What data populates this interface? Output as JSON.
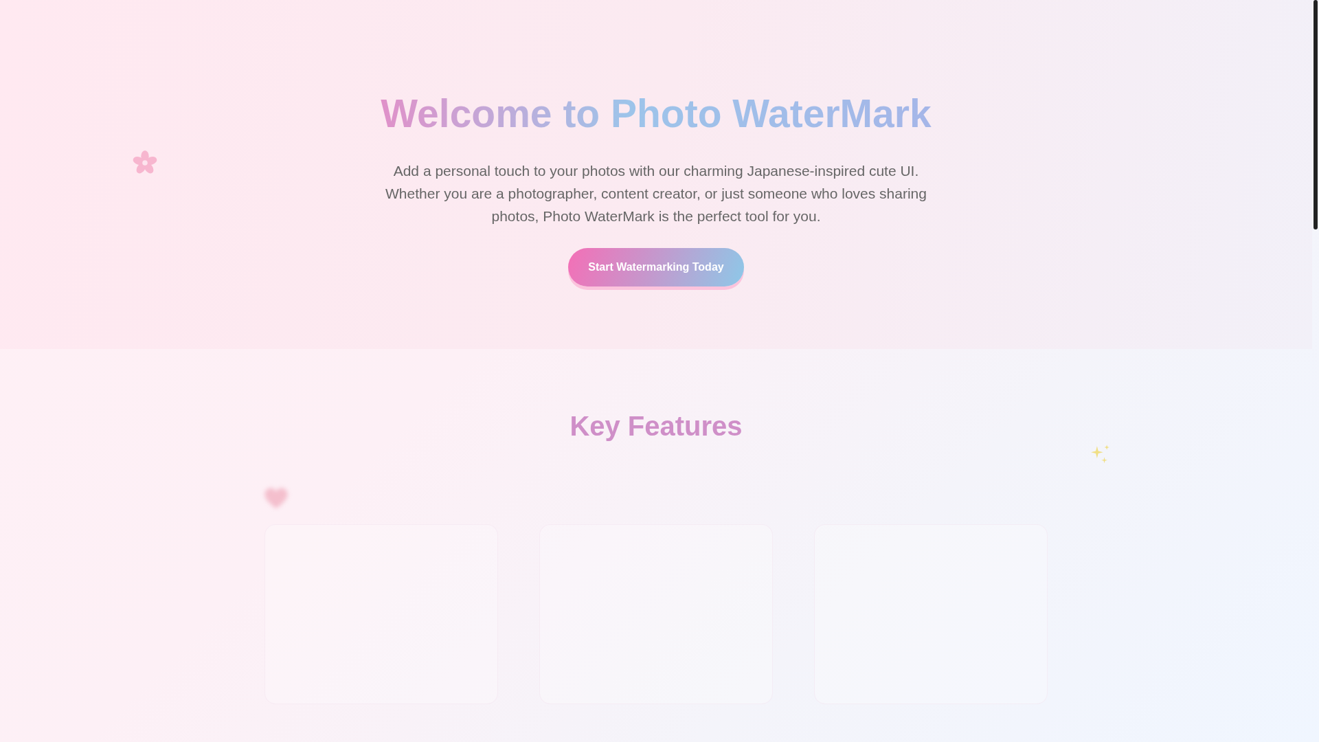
{
  "hero": {
    "title": "Welcome to Photo WaterMark",
    "description": "Add a personal touch to your photos with our charming Japanese-inspired cute UI. Whether you are a photographer, content creator, or just someone who loves sharing photos, Photo WaterMark is the perfect tool for you.",
    "button": "Start Watermarking Today"
  },
  "features": {
    "title": "Key Features",
    "cards": [
      {
        "kind": "card"
      },
      {
        "kind": "card"
      },
      {
        "kind": "card"
      }
    ]
  }
}
